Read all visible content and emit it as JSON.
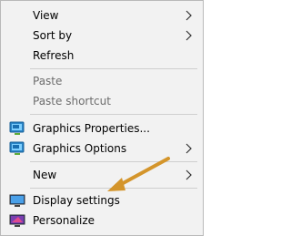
{
  "menu": {
    "items": {
      "view": {
        "label": "View",
        "icon": "chevron-right-icon"
      },
      "sort_by": {
        "label": "Sort by",
        "icon": "chevron-right-icon"
      },
      "refresh": {
        "label": "Refresh"
      },
      "paste": {
        "label": "Paste",
        "enabled": false
      },
      "paste_shortcut": {
        "label": "Paste shortcut",
        "enabled": false
      },
      "graphics_properties": {
        "label": "Graphics Properties...",
        "icon": "intel-graphics-icon"
      },
      "graphics_options": {
        "label": "Graphics Options",
        "icon": "intel-graphics-icon"
      },
      "new": {
        "label": "New",
        "icon": "chevron-right-icon"
      },
      "display_settings": {
        "label": "Display settings",
        "icon": "monitor-icon"
      },
      "personalize": {
        "label": "Personalize",
        "icon": "personalize-monitor-icon"
      }
    }
  },
  "colors": {
    "menu_bg": "#f2f2f2",
    "separator": "#cfcfcf",
    "disabled_text": "#6d6d6d",
    "annotation_arrow": "#d4952b"
  }
}
